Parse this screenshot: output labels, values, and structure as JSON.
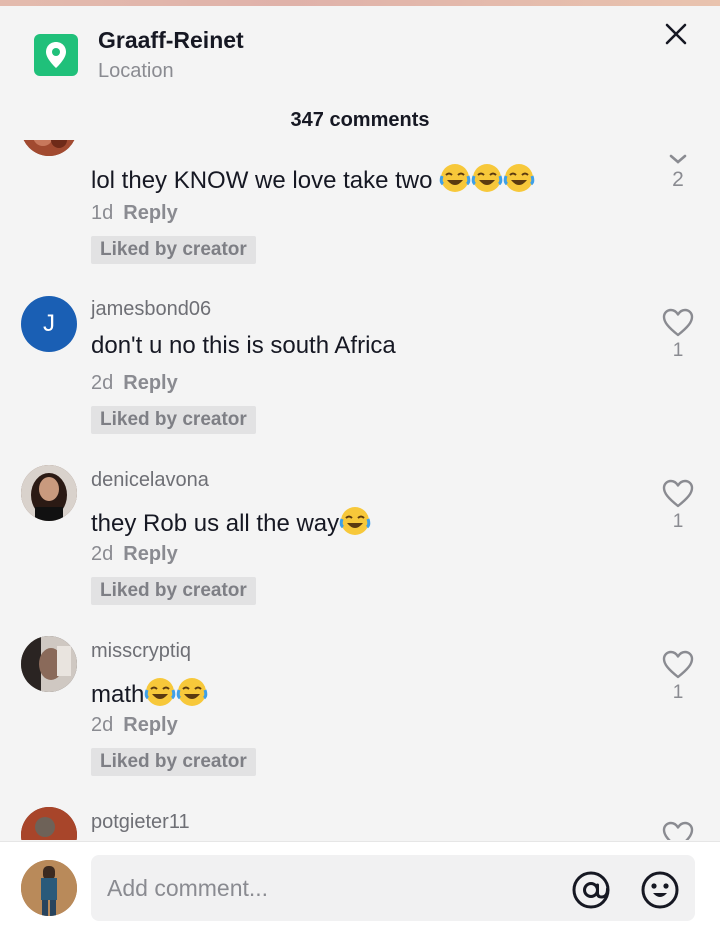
{
  "header": {
    "location_title": "Graaff-Reinet",
    "location_subtitle": "Location",
    "comments_count": "347 comments"
  },
  "comments": [
    {
      "username": "",
      "text": "lol they KNOW we love take two",
      "emoji_count": 3,
      "time": "1d",
      "reply": "Reply",
      "badge": "Liked by creator",
      "likes": "2",
      "avatar_icon": "partial-avatar"
    },
    {
      "username": "jamesbond06",
      "text": "don't u no this is south Africa",
      "emoji_count": 0,
      "time": "2d",
      "reply": "Reply",
      "badge": "Liked by creator",
      "likes": "1",
      "avatar_letter": "J",
      "avatar_color": "#1a5fb4"
    },
    {
      "username": "denicelavona",
      "text": "they Rob us all the way",
      "emoji_count": 1,
      "time": "2d",
      "reply": "Reply",
      "badge": "Liked by creator",
      "likes": "1",
      "avatar_icon": "photo-avatar"
    },
    {
      "username": "misscryptiq",
      "text": "math",
      "emoji_count": 2,
      "time": "2d",
      "reply": "Reply",
      "badge": "Liked by creator",
      "likes": "1",
      "avatar_icon": "photo-avatar"
    },
    {
      "username": "potgieter11",
      "avatar_icon": "photo-avatar"
    }
  ],
  "composer": {
    "placeholder": "Add comment...",
    "mention_icon": "at-icon",
    "emoji_icon": "smiley-icon"
  },
  "colors": {
    "location_green": "#20c07a",
    "badge_bg": "#e2e2e3",
    "muted_text": "#8a8b91"
  }
}
